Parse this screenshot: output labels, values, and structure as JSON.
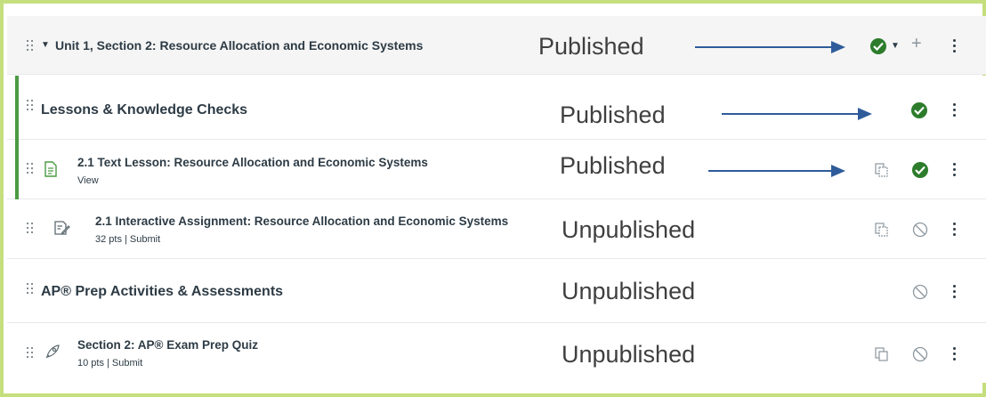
{
  "module": {
    "title": "Unit 1, Section 2: Resource Allocation and Economic Systems",
    "status": "Published"
  },
  "items": [
    {
      "title": "Lessons & Knowledge Checks",
      "status": "Published",
      "type": "subheader"
    },
    {
      "title": "2.1 Text Lesson: Resource Allocation and Economic Systems",
      "meta": "View",
      "status": "Published",
      "type": "page"
    },
    {
      "title": "2.1 Interactive Assignment: Resource Allocation and Economic Systems",
      "meta": "32 pts | Submit",
      "status": "Unpublished",
      "type": "assignment"
    },
    {
      "title": "AP® Prep Activities & Assessments",
      "status": "Unpublished",
      "type": "subheader"
    },
    {
      "title": "Section 2: AP® Exam Prep Quiz",
      "meta": "10 pts | Submit",
      "status": "Unpublished",
      "type": "quiz"
    }
  ],
  "colors": {
    "published": "#2c7c2c",
    "accent_border": "#c5df7e",
    "arrow": "#2e5c9a",
    "left_bar": "#4c9a44"
  },
  "icons": [
    "drag-handle-icon",
    "caret-down-icon",
    "page-icon",
    "assignment-icon",
    "quiz-rocket-icon",
    "published-check-icon",
    "unpublished-circle-icon",
    "duplicate-icon",
    "plus-icon",
    "kebab-menu-icon"
  ]
}
